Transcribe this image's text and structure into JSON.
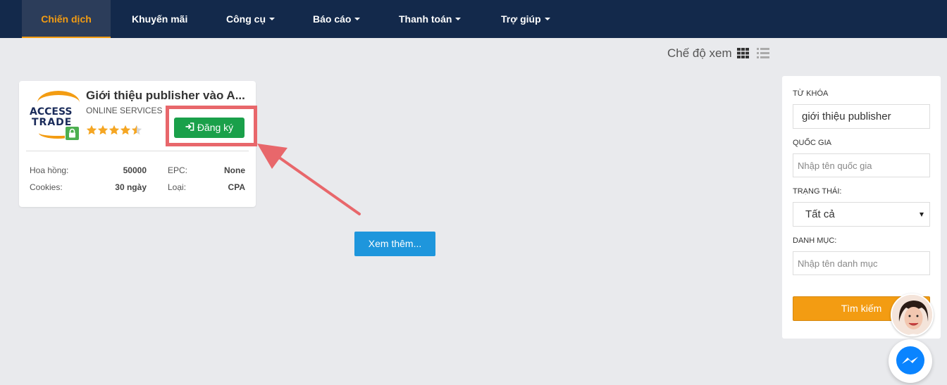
{
  "nav": {
    "items": [
      {
        "label": "Chiến dịch",
        "caret": false
      },
      {
        "label": "Khuyến mãi",
        "caret": false
      },
      {
        "label": "Công cụ",
        "caret": true
      },
      {
        "label": "Báo cáo",
        "caret": true
      },
      {
        "label": "Thanh toán",
        "caret": true
      },
      {
        "label": "Trợ giúp",
        "caret": true
      }
    ],
    "colors": {
      "bg": "#13294b",
      "active_text": "#f39c12"
    }
  },
  "view_mode": {
    "label": "Chế độ xem",
    "icons": [
      "grid-icon",
      "list-icon"
    ]
  },
  "card": {
    "title": "Giới thiệu publisher vào A...",
    "category": "ONLINE SERVICES",
    "logo": {
      "line1": "ACCESS",
      "line2": "TRADE"
    },
    "rating": 4.5,
    "rating_max": 5,
    "register_label": "Đăng ký",
    "stats": {
      "commission_label": "Hoa hồng:",
      "commission_value": "50000",
      "epc_label": "EPC:",
      "epc_value": "None",
      "cookies_label": "Cookies:",
      "cookies_value": "30 ngày",
      "type_label": "Loại:",
      "type_value": "CPA"
    }
  },
  "see_more_label": "Xem thêm...",
  "sidebar": {
    "keyword_label": "TỪ KHÓA",
    "keyword_value": "giới thiệu publisher",
    "country_label": "QUỐC GIA",
    "country_placeholder": "Nhập tên quốc gia",
    "status_label": "TRẠNG THÁI:",
    "status_value": "Tất cả",
    "category_label": "DANH MỤC:",
    "category_placeholder": "Nhập tên danh mục",
    "search_label": "Tìm kiếm"
  },
  "colors": {
    "green": "#1aa04a",
    "orange": "#f39c12",
    "blue": "#1e96dc",
    "highlight": "#e8676b"
  }
}
